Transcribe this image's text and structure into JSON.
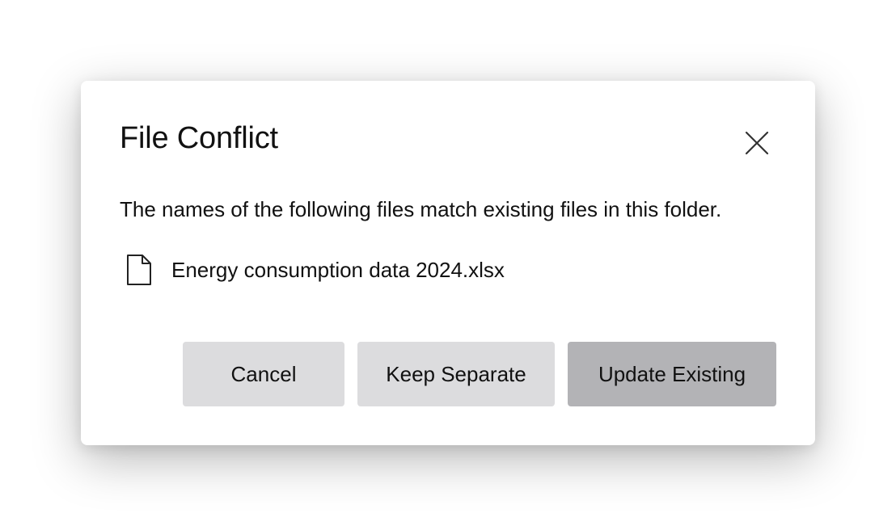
{
  "dialog": {
    "title": "File Conflict",
    "close_icon": "close-icon",
    "message": "The names of the following files match existing files in this folder.",
    "files": [
      {
        "icon": "file-icon",
        "name": "Energy consumption data 2024.xlsx"
      }
    ],
    "buttons": {
      "cancel_label": "Cancel",
      "keep_separate_label": "Keep Separate",
      "update_existing_label": "Update Existing"
    }
  },
  "colors": {
    "dialog_background": "#ffffff",
    "secondary_button": "#dcdcde",
    "primary_button": "#b3b3b6",
    "text": "#111111"
  }
}
